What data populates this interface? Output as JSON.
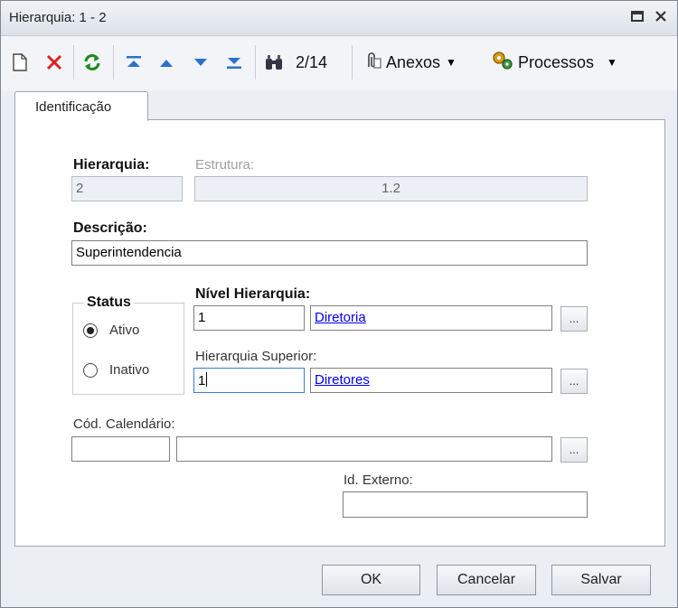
{
  "window": {
    "title": "Hierarquia: 1 - 2",
    "restore_icon": "restore-icon",
    "close_icon": "close-icon"
  },
  "toolbar": {
    "record_position": "2/14",
    "attachments_label": "Anexos",
    "processes_label": "Processos",
    "icons": [
      "new-document-icon",
      "delete-icon",
      "refresh-icon",
      "first-record-icon",
      "previous-record-icon",
      "next-record-icon",
      "last-record-icon",
      "binoculars-icon",
      "paperclip-icon",
      "gears-icon"
    ]
  },
  "tabs": [
    {
      "label": "Identificação",
      "active": true
    }
  ],
  "form": {
    "hierarquia_label": "Hierarquia:",
    "hierarquia_value": "2",
    "estrutura_label": "Estrutura:",
    "estrutura_value": "1.2",
    "descricao_label": "Descrição:",
    "descricao_value": "Superintendencia",
    "status_label": "Status",
    "status_options": [
      {
        "label": "Ativo",
        "checked": true
      },
      {
        "label": "Inativo",
        "checked": false
      }
    ],
    "nivel_label": "Nível Hierarquia:",
    "nivel_code": "1",
    "nivel_desc": "Diretoria",
    "superior_label": "Hierarquia Superior:",
    "superior_code": "1",
    "superior_desc": "Diretores",
    "calendario_label": "Cód. Calendário:",
    "calendario_code": "",
    "calendario_desc": "",
    "externo_label": "Id. Externo:",
    "externo_value": "",
    "ellipsis": "..."
  },
  "footer": {
    "ok": "OK",
    "cancel": "Cancelar",
    "save": "Salvar"
  }
}
